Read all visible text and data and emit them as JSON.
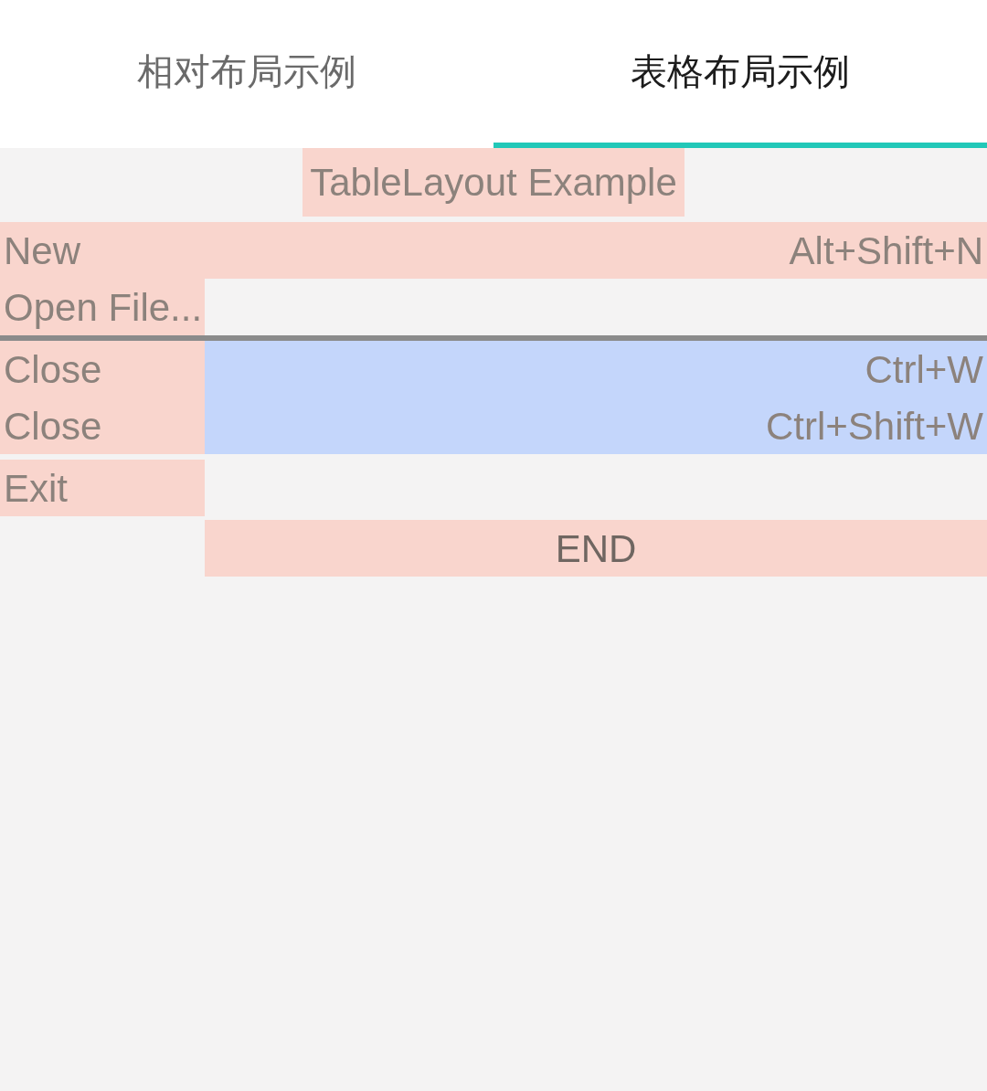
{
  "tabs": [
    {
      "label": "相对布局示例",
      "selected": false
    },
    {
      "label": "表格布局示例",
      "selected": true
    }
  ],
  "table": {
    "title": {
      "text": "TableLayout Example",
      "color": "#f9d5cd"
    },
    "sections": [
      {
        "kind": "rows",
        "rows": [
          {
            "cells": [
              {
                "text": "New",
                "color": "#f9d5cd"
              },
              {
                "text": "Alt+Shift+N",
                "color": "#f9d5cd"
              }
            ]
          },
          {
            "cells": [
              {
                "text": "Open File...",
                "color": "#f9d5cd"
              }
            ]
          }
        ]
      },
      {
        "kind": "divider"
      },
      {
        "kind": "rows",
        "rows": [
          {
            "cells": [
              {
                "text": "Close",
                "color": "#f9d5cd"
              },
              {
                "text": "Ctrl+W",
                "color": "#c4d6fb"
              }
            ]
          },
          {
            "cells": [
              {
                "text": "Close",
                "color": "#f9d5cd"
              },
              {
                "text": "Ctrl+Shift+W",
                "color": "#c4d6fb"
              }
            ]
          }
        ]
      },
      {
        "kind": "rows",
        "rows": [
          {
            "cells": [
              {
                "text": "Exit",
                "color": "#f9d5cd"
              }
            ]
          }
        ]
      },
      {
        "kind": "footer",
        "text": "END",
        "color": "#f9d5cd"
      }
    ]
  }
}
